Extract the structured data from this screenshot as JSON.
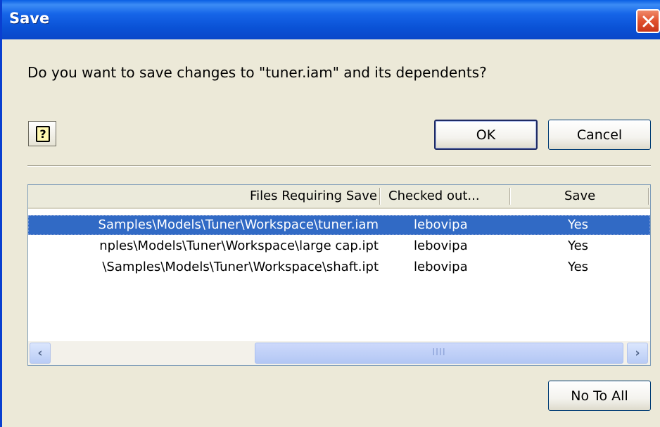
{
  "window": {
    "title": "Save",
    "close_glyph": "✕"
  },
  "message": "Do you want to save changes to \"tuner.iam\" and its dependents?",
  "buttons": {
    "help_glyph": "?",
    "ok": "OK",
    "cancel": "Cancel",
    "no_to_all": "No To All"
  },
  "list": {
    "columns": [
      "Files Requiring Save",
      "Checked out...",
      "Save"
    ],
    "rows": [
      {
        "file": "Samples\\Models\\Tuner\\Workspace\\tuner.iam",
        "checked_out_by": "lebovipa",
        "save": "Yes",
        "selected": true
      },
      {
        "file": "nples\\Models\\Tuner\\Workspace\\large cap.ipt",
        "checked_out_by": "lebovipa",
        "save": "Yes",
        "selected": false
      },
      {
        "file": "\\Samples\\Models\\Tuner\\Workspace\\shaft.ipt",
        "checked_out_by": "lebovipa",
        "save": "Yes",
        "selected": false
      }
    ]
  },
  "scrollbar": {
    "left_glyph": "‹",
    "right_glyph": "›",
    "grip_glyph": "IIII",
    "position_fraction": 0.36
  },
  "colors": {
    "titlebar": "#0a52d6",
    "selection": "#316ac5",
    "dialog_bg": "#ece9d8",
    "close_button": "#e0512e"
  },
  "icons": [
    "help-icon",
    "close-icon",
    "scroll-left-icon",
    "scroll-right-icon"
  ]
}
